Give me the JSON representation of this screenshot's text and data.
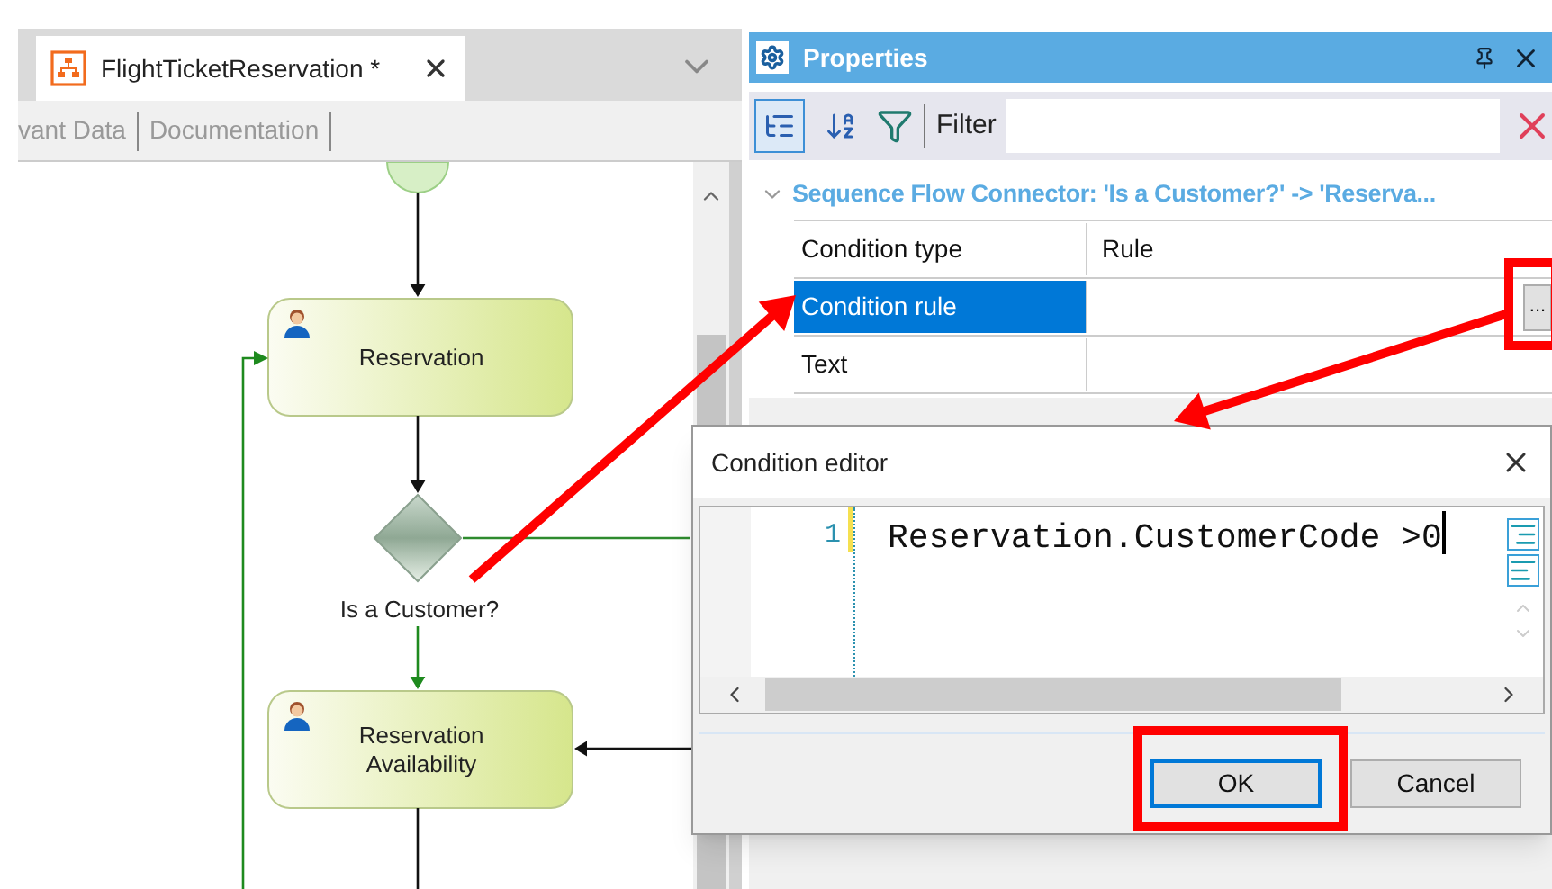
{
  "editor_tab": {
    "title": "FlightTicketReservation *",
    "selected": true
  },
  "designer_tabs": [
    "vant Data",
    "Documentation"
  ],
  "diagram": {
    "tasks": [
      {
        "label": "Reservation"
      },
      {
        "label": "Reservation Availability"
      }
    ],
    "gateway": {
      "label": "Is a Customer?"
    }
  },
  "properties": {
    "title": "Properties",
    "view_buttons": [
      {
        "kind": "categorized",
        "selected": true
      },
      {
        "kind": "alphabetical",
        "selected": false
      }
    ],
    "filter_label": "Filter",
    "category": {
      "title": "Sequence Flow Connector: 'Is a Customer?' -> 'Reserva...",
      "expanded": true
    },
    "rows": [
      {
        "name": "Condition type",
        "value": "Rule",
        "selected": false
      },
      {
        "name": "Condition rule",
        "value": "",
        "selected": true,
        "button": "..."
      },
      {
        "name": "Text",
        "value": "",
        "selected": false
      }
    ]
  },
  "dialog": {
    "title": "Condition editor",
    "lines": [
      {
        "number": "1",
        "code": "Reservation.CustomerCode >0"
      }
    ],
    "buttons": [
      {
        "label": "OK",
        "default": true
      },
      {
        "label": "Cancel",
        "default": false
      }
    ]
  }
}
